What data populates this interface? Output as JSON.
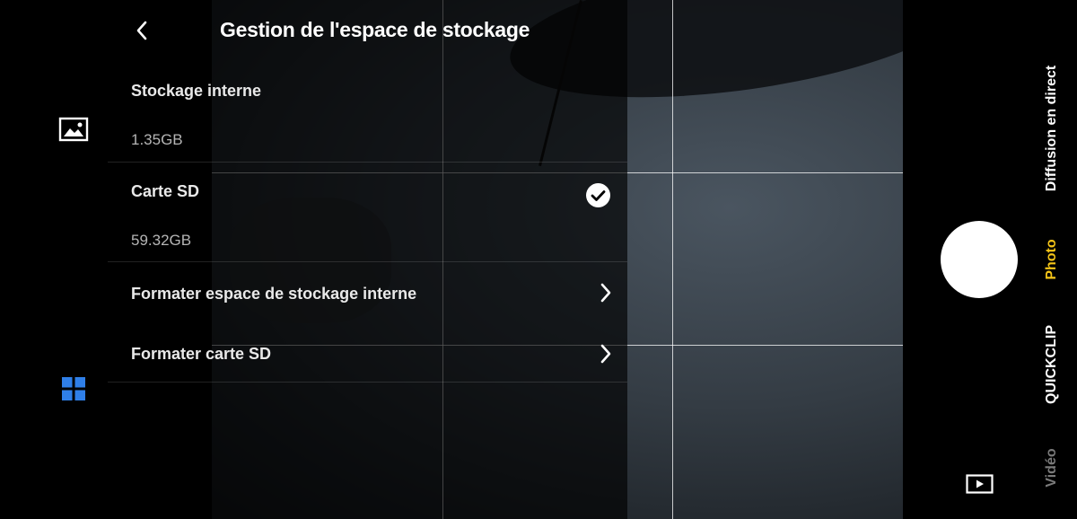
{
  "panel": {
    "title": "Gestion de l'espace de stockage",
    "back_icon": "chevron-left-icon",
    "internal_storage": {
      "label": "Stockage interne",
      "size": "1.35GB"
    },
    "sd_card": {
      "label": "Carte SD",
      "size": "59.32GB",
      "selected": true,
      "selected_icon": "check-circle-icon"
    },
    "format_internal": {
      "label": "Formater espace de stockage interne",
      "icon": "chevron-right-icon"
    },
    "format_sd": {
      "label": "Formater carte SD",
      "icon": "chevron-right-icon"
    }
  },
  "left_rail": {
    "gallery_icon": "gallery-icon",
    "modules_icon": "grid-icon"
  },
  "right_rail": {
    "modes": [
      {
        "label": "Diffusion en direct",
        "active": false
      },
      {
        "label": "Photo",
        "active": true
      },
      {
        "label": "QUICKCLIP",
        "active": false
      },
      {
        "label": "Vidéo",
        "active": false
      }
    ],
    "shutter_icon": "shutter-button",
    "playback_icon": "playback-icon"
  },
  "colors": {
    "active_mode": "#f5c518",
    "inactive_mode": "#ffffff",
    "dim_mode": "#7a7a7a",
    "modules_icon": "#2f7fe8"
  }
}
